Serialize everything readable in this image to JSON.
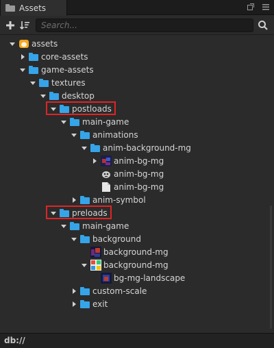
{
  "panel": {
    "title": "Assets"
  },
  "toolbar": {
    "search_placeholder": "Search..."
  },
  "tree": [
    {
      "label": "assets",
      "depth": 0,
      "arrow": "down",
      "icon": "db-icon"
    },
    {
      "label": "core-assets",
      "depth": 1,
      "arrow": "right",
      "icon": "folder-icon"
    },
    {
      "label": "game-assets",
      "depth": 1,
      "arrow": "down",
      "icon": "folder-icon"
    },
    {
      "label": "textures",
      "depth": 2,
      "arrow": "down",
      "icon": "folder-icon"
    },
    {
      "label": "desktop",
      "depth": 3,
      "arrow": "down",
      "icon": "folder-icon"
    },
    {
      "label": "postloads",
      "depth": 4,
      "arrow": "down",
      "icon": "folder-icon",
      "highlight": true
    },
    {
      "label": "main-game",
      "depth": 5,
      "arrow": "down",
      "icon": "folder-icon"
    },
    {
      "label": "animations",
      "depth": 6,
      "arrow": "down",
      "icon": "folder-icon"
    },
    {
      "label": "anim-background-mg",
      "depth": 7,
      "arrow": "down",
      "icon": "folder-icon"
    },
    {
      "label": "anim-bg-mg",
      "depth": 8,
      "arrow": "right",
      "icon": "spritesheet-icon"
    },
    {
      "label": "anim-bg-mg",
      "depth": 8,
      "arrow": "none",
      "icon": "skeleton-icon"
    },
    {
      "label": "anim-bg-mg",
      "depth": 8,
      "arrow": "none",
      "icon": "file-icon"
    },
    {
      "label": "anim-symbol",
      "depth": 6,
      "arrow": "right",
      "icon": "folder-icon"
    },
    {
      "label": "preloads",
      "depth": 4,
      "arrow": "down",
      "icon": "folder-icon",
      "highlight": true
    },
    {
      "label": "main-game",
      "depth": 5,
      "arrow": "down",
      "icon": "folder-icon"
    },
    {
      "label": "background",
      "depth": 6,
      "arrow": "down",
      "icon": "folder-icon"
    },
    {
      "label": "background-mg",
      "depth": 7,
      "arrow": "none",
      "icon": "texture-icon"
    },
    {
      "label": "background-mg",
      "depth": 7,
      "arrow": "down",
      "icon": "atlas-icon"
    },
    {
      "label": "bg-mg-landscape",
      "depth": 8,
      "arrow": "none",
      "icon": "spriteframe-icon"
    },
    {
      "label": "custom-scale",
      "depth": 6,
      "arrow": "right",
      "icon": "folder-icon"
    },
    {
      "label": "exit",
      "depth": 6,
      "arrow": "right",
      "icon": "folder-icon"
    }
  ],
  "statusbar": {
    "path": "db://"
  },
  "colors": {
    "folder": "#36a4e8",
    "highlight": "#e02424",
    "background": "#2b2b2b"
  }
}
